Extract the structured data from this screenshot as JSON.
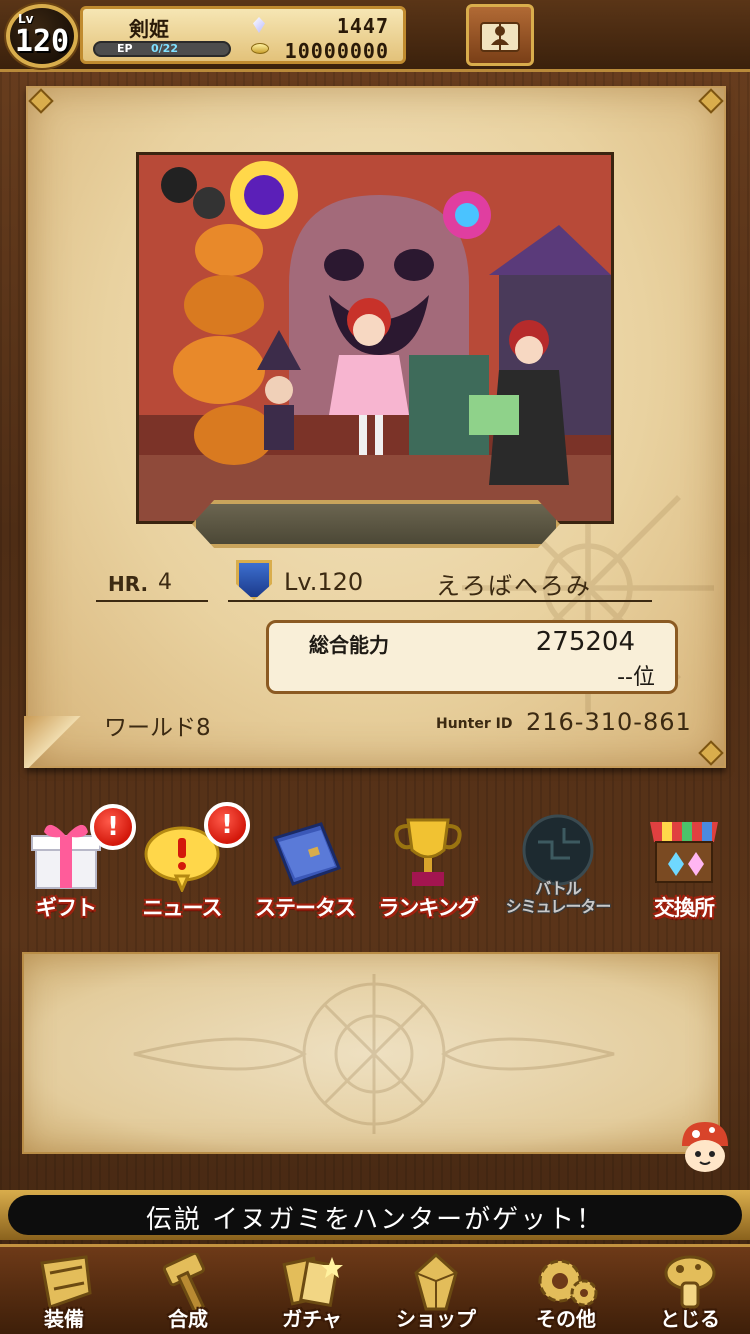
{
  "header": {
    "lv_prefix": "Lv",
    "level": "120",
    "title": "剣姫",
    "ep_label": "EP",
    "ep_value": "0/22",
    "gems": "1447",
    "coins": "10000000"
  },
  "profile": {
    "hr_label": "HR.",
    "hr_value": "4",
    "level_text": "Lv.120",
    "player_name": "えろばへろみ",
    "power_label": "総合能力",
    "power_value": "275204",
    "power_rank": "--位",
    "world": "ワールド8",
    "hunter_id_label": "Hunter ID",
    "hunter_id": "216-310-861"
  },
  "menu": [
    {
      "label": "ギフト",
      "alert": "!"
    },
    {
      "label": "ニュース",
      "alert": "!"
    },
    {
      "label": "ステータス"
    },
    {
      "label": "ランキング"
    },
    {
      "label": "バトル\nシミュレーター"
    },
    {
      "label": "交換所"
    }
  ],
  "ticker": {
    "text": "伝説 イヌガミをハンターがゲット！"
  },
  "nav": [
    {
      "label": "装備"
    },
    {
      "label": "合成"
    },
    {
      "label": "ガチャ"
    },
    {
      "label": "ショップ"
    },
    {
      "label": "その他"
    },
    {
      "label": "とじる"
    }
  ],
  "colors": {
    "wood": "#4e2d15",
    "parchment": "#f3e3bf",
    "gold": "#d9ad4c",
    "alert_red": "#d3180b"
  }
}
